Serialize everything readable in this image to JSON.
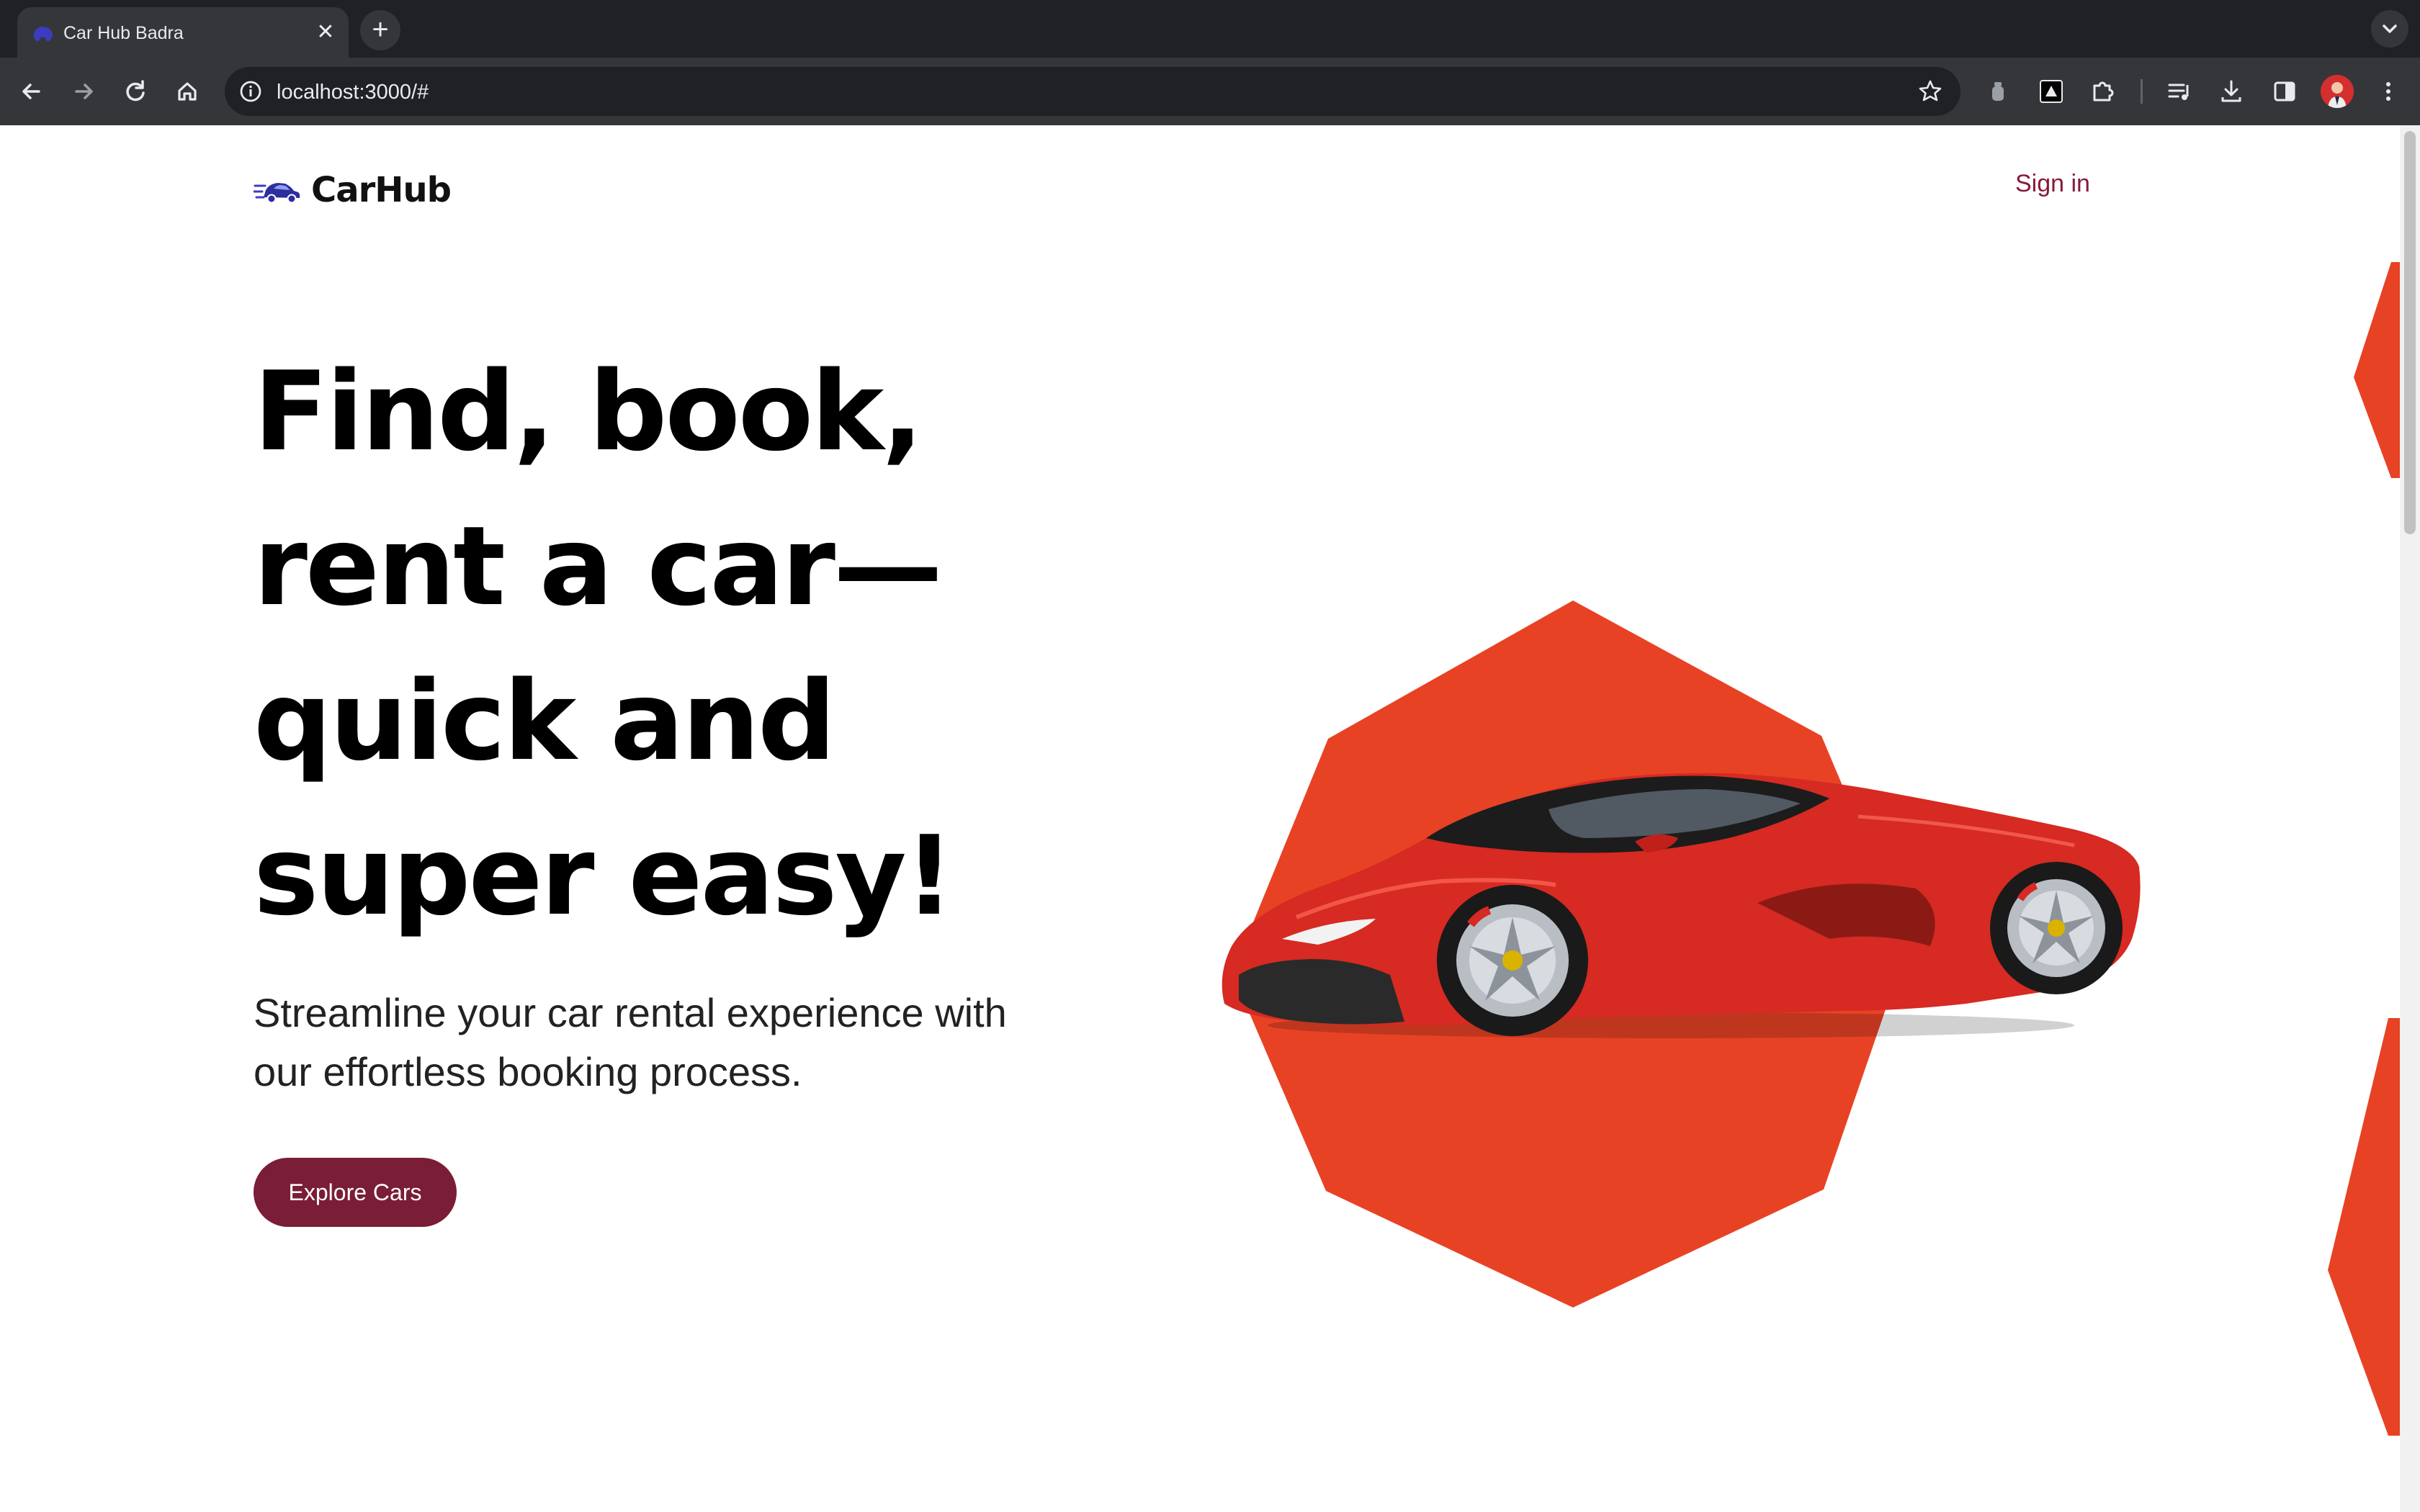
{
  "browser": {
    "tab_title": "Car Hub Badra",
    "tab_close": "✕",
    "new_tab": "+",
    "url": "localhost:3000/#"
  },
  "header": {
    "logo_text": "CarHub",
    "sign_in": "Sign in"
  },
  "hero": {
    "headline_lines": [
      "Find, book,",
      "rent a car—",
      "quick and",
      "super easy!"
    ],
    "subtitle_lines": [
      "Streamline your car rental experience with",
      "our effortless booking process."
    ],
    "cta_label": "Explore Cars"
  },
  "colors": {
    "accent": "#7a1d36",
    "sign_in": "#861a3a",
    "hexagon": "#e84225",
    "car_body": "#d62a22"
  }
}
